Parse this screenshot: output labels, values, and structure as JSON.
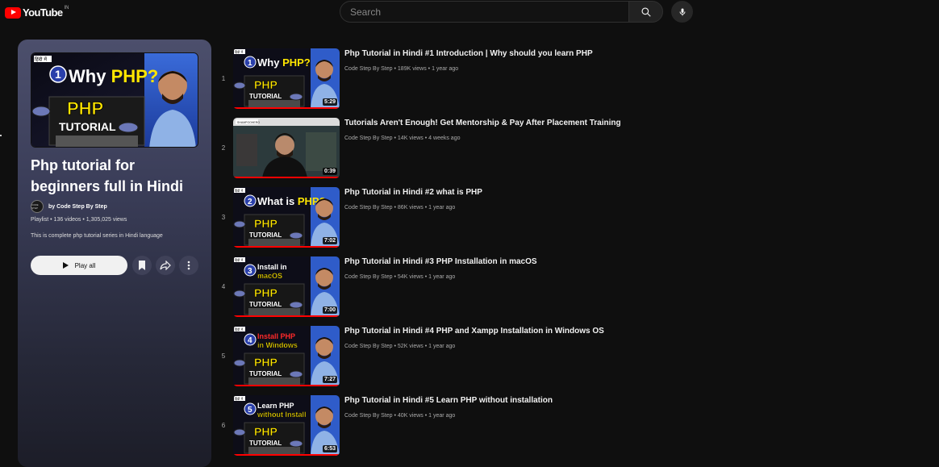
{
  "header": {
    "logo_text": "YouTube",
    "country": "IN",
    "search_placeholder": "Search"
  },
  "playlist": {
    "title": "Php tutorial for beginners full in Hindi",
    "channel_avatar_text": "CODE STEP",
    "channel_by": "by Code Step By Step",
    "type_label": "Playlist",
    "video_count": "136 videos",
    "view_count": "1,305,025 views",
    "description": "This is complete php tutorial series in Hindi language",
    "play_all_label": "Play all",
    "cover_text": {
      "tag": "हिंदी में",
      "number": "1",
      "headline_a": "Why ",
      "headline_b": "PHP?",
      "php": "PHP",
      "tutorial": "TUTORIAL"
    }
  },
  "videos": [
    {
      "index": "1",
      "title": "Php Tutorial in Hindi #1 Introduction | Why should you learn PHP",
      "channel": "Code Step By Step",
      "views": "189K views",
      "age": "1 year ago",
      "duration": "5:29",
      "thumb_kind": "php",
      "thumb_num": "1",
      "thumb_l1": "Why ",
      "thumb_l1b": "PHP?",
      "thumb_l2": "",
      "thumb_color": "#ffffff",
      "thumb_color_b": "#ffe600"
    },
    {
      "index": "2",
      "title": "Tutorials Aren't Enough! Get Mentorship & Pay After Placement Training",
      "channel": "Code Step By Step",
      "views": "14K views",
      "age": "4 weeks ago",
      "duration": "0:39",
      "thumb_kind": "person",
      "thumb_num": "",
      "thumb_l1": "",
      "thumb_l1b": "",
      "thumb_l2": "",
      "thumb_color": "#ffffff",
      "thumb_color_b": "#ffffff"
    },
    {
      "index": "3",
      "title": "Php Tutorial in Hindi #2 what is PHP",
      "channel": "Code Step By Step",
      "views": "86K views",
      "age": "1 year ago",
      "duration": "7:02",
      "thumb_kind": "php",
      "thumb_num": "2",
      "thumb_l1": "What is ",
      "thumb_l1b": "PHP?",
      "thumb_l2": "",
      "thumb_color": "#ffffff",
      "thumb_color_b": "#ffe600"
    },
    {
      "index": "4",
      "title": "Php Tutorial in Hindi #3 PHP Installation in macOS",
      "channel": "Code Step By Step",
      "views": "54K views",
      "age": "1 year ago",
      "duration": "7:00",
      "thumb_kind": "php",
      "thumb_num": "3",
      "thumb_l1": "Install in",
      "thumb_l1b": "",
      "thumb_l2": "macOS",
      "thumb_color": "#ffffff",
      "thumb_color_b": "#ffe600"
    },
    {
      "index": "5",
      "title": "Php Tutorial in Hindi #4 PHP and Xampp Installation in Windows OS",
      "channel": "Code Step By Step",
      "views": "52K views",
      "age": "1 year ago",
      "duration": "7:27",
      "thumb_kind": "php",
      "thumb_num": "4",
      "thumb_l1": "Install PHP",
      "thumb_l1b": "",
      "thumb_l2": "in Windows",
      "thumb_color": "#ff2a2a",
      "thumb_color_b": "#ffe600"
    },
    {
      "index": "6",
      "title": "Php Tutorial in Hindi #5 Learn PHP without installation",
      "channel": "Code Step By Step",
      "views": "40K views",
      "age": "1 year ago",
      "duration": "6:53",
      "thumb_kind": "php",
      "thumb_num": "5",
      "thumb_l1": "Learn PHP",
      "thumb_l1b": "",
      "thumb_l2": "without Install",
      "thumb_color": "#ffffff",
      "thumb_color_b": "#ffe600"
    }
  ],
  "thumb_common": {
    "tag": "हिंदी में",
    "php": "PHP",
    "tutorial": "TUTORIAL",
    "person_badge": "SHAMPOOHERO"
  },
  "colors": {
    "brand_red": "#ff0000",
    "panel_top": "#4c4f6c",
    "php_yellow": "#ffe600"
  }
}
